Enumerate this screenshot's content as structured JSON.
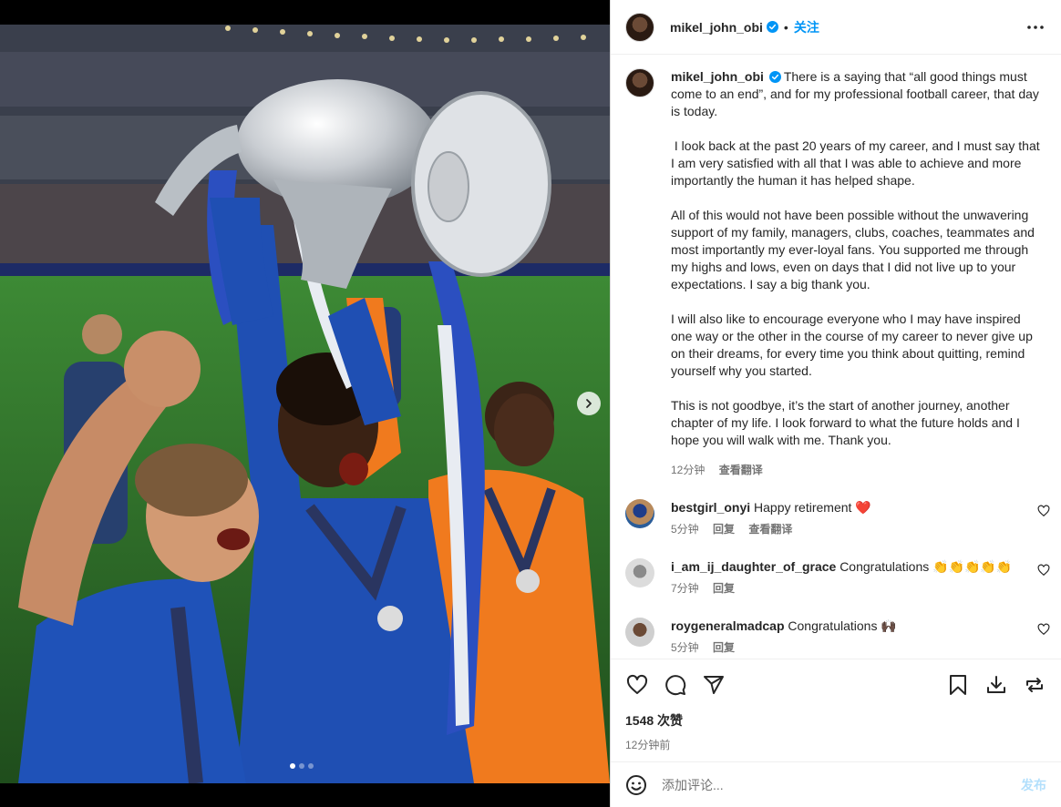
{
  "post": {
    "username": "mikel_john_obi",
    "follow_label": "关注",
    "separator": "•",
    "caption_paragraphs": [
      "There is a saying that “all good things must come to an end”, and for my professional football career, that day is today.",
      " I look back at the past 20 years of my career, and I must say that I am very satisfied with all that I was able to achieve and more importantly the human it has helped shape.",
      "All of this would not have been possible without the unwavering support of my family, managers, clubs, coaches, teammates and most importantly my ever-loyal fans. You supported me through my highs and lows, even on days that I did not live up to your expectations. I say a big thank you.",
      "I will also like to encourage everyone who I may have inspired one way or the other in the course of my career to never give up on their dreams, for every time you think about quitting, remind yourself why you started.",
      "This is not goodbye, it’s the start of another journey, another chapter of my life. I look forward to what the future holds and I hope you will walk with me. Thank you."
    ],
    "caption_time": "12分钟",
    "see_translation": "查看翻译",
    "likes": "1548 次赞",
    "posted_ago": "12分钟前",
    "carousel": {
      "slides": 3,
      "active_index": 0
    }
  },
  "comments": [
    {
      "username": "bestgirl_onyi",
      "text": "Happy retirement ",
      "emoji": "❤️",
      "time": "5分钟",
      "reply": "回复",
      "translate": "查看翻译"
    },
    {
      "username": "i_am_ij_daughter_of_grace",
      "text": "Congratulations ",
      "emoji": "👏👏👏👏👏",
      "time": "7分钟",
      "reply": "回复"
    },
    {
      "username": "roygeneralmadcap",
      "text": "Congratulations ",
      "emoji": "🙌🏿",
      "time": "5分钟",
      "reply": "回复"
    }
  ],
  "composer": {
    "placeholder": "添加评论...",
    "post_label": "发布"
  },
  "icons": {
    "header_more": "more-horizontal-icon",
    "verified": "verified-badge-icon",
    "next": "chevron-right-icon",
    "like": "heart-icon",
    "comment": "comment-bubble-icon",
    "share": "paper-plane-icon",
    "save": "bookmark-icon",
    "download": "download-icon",
    "repost": "repost-icon",
    "emoji": "emoji-smile-icon"
  },
  "colors": {
    "accent": "#0095f6",
    "post_disabled": "#b2dffc",
    "heart": "#ed4956",
    "chelsea_blue": "#1f4fb3",
    "keeper_orange": "#f07a1e"
  }
}
